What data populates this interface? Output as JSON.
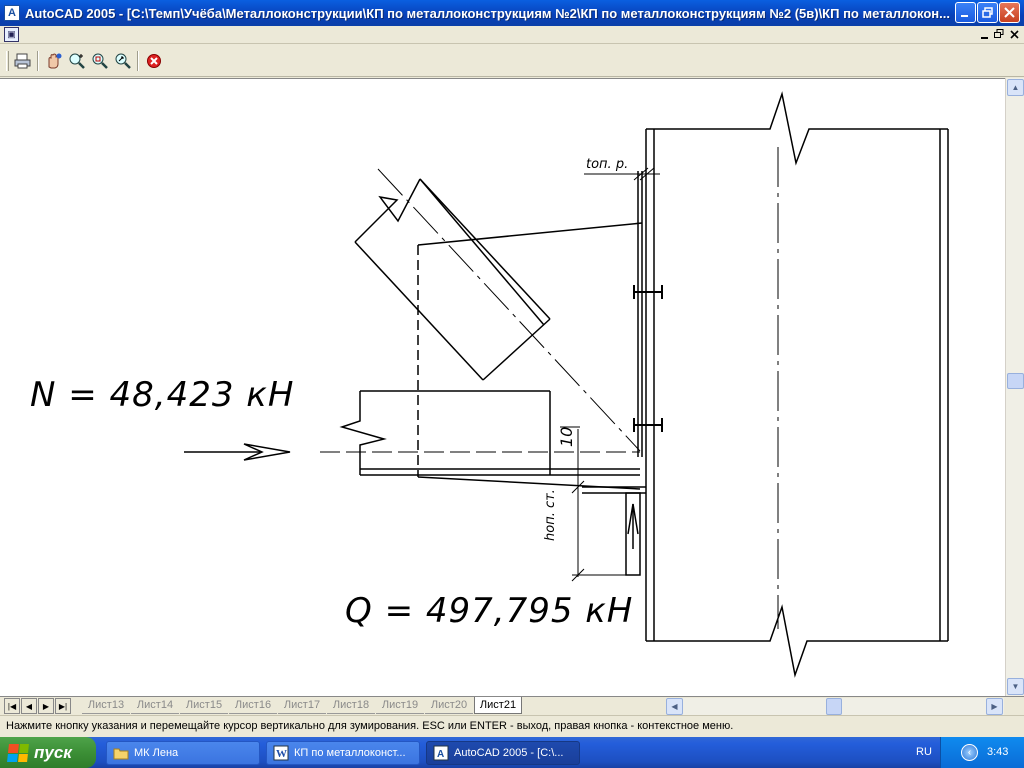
{
  "window": {
    "title": "AutoCAD 2005 - [C:\\Темп\\Учёба\\Металлоконструкции\\КП по металлоконструкциям №2\\КП по металлоконструкциям №2 (5в)\\КП по металлокон..."
  },
  "drawing": {
    "label_N": "N  =  48,423 кН",
    "label_Q": "Q  =  497,795 кН",
    "dim_top": "tоп. р.",
    "dim_side": "hоп. ст.",
    "dim_10": "10"
  },
  "tabs": [
    {
      "label": "Лист13",
      "active": false
    },
    {
      "label": "Лист14",
      "active": false
    },
    {
      "label": "Лист15",
      "active": false
    },
    {
      "label": "Лист16",
      "active": false
    },
    {
      "label": "Лист17",
      "active": false
    },
    {
      "label": "Лист18",
      "active": false
    },
    {
      "label": "Лист19",
      "active": false
    },
    {
      "label": "Лист20",
      "active": false
    },
    {
      "label": "Лист21",
      "active": true
    }
  ],
  "status": {
    "text": "Нажмите кнопку указания и перемещайте курсор вертикально для зумирования. ESC или ENTER - выход, правая кнопка - контекстное меню."
  },
  "taskbar": {
    "start_label": "пуск",
    "tasks": [
      {
        "label": "МК Лена"
      },
      {
        "label": "КП по металлоконст..."
      },
      {
        "label": "AutoCAD 2005 - [C:\\..."
      }
    ],
    "lang": "RU",
    "clock": "3:43"
  },
  "colors": {
    "title_bar": "#0a5fe0",
    "taskbar": "#245edb",
    "start_button": "#3c8f36",
    "close_button": "#c7401f"
  },
  "icons": {
    "app": "autocad-icon",
    "toolbar": [
      "print-preview-icon",
      "pan-icon",
      "zoom-realtime-icon",
      "zoom-window-icon",
      "zoom-original-icon",
      "close-preview-icon"
    ]
  }
}
